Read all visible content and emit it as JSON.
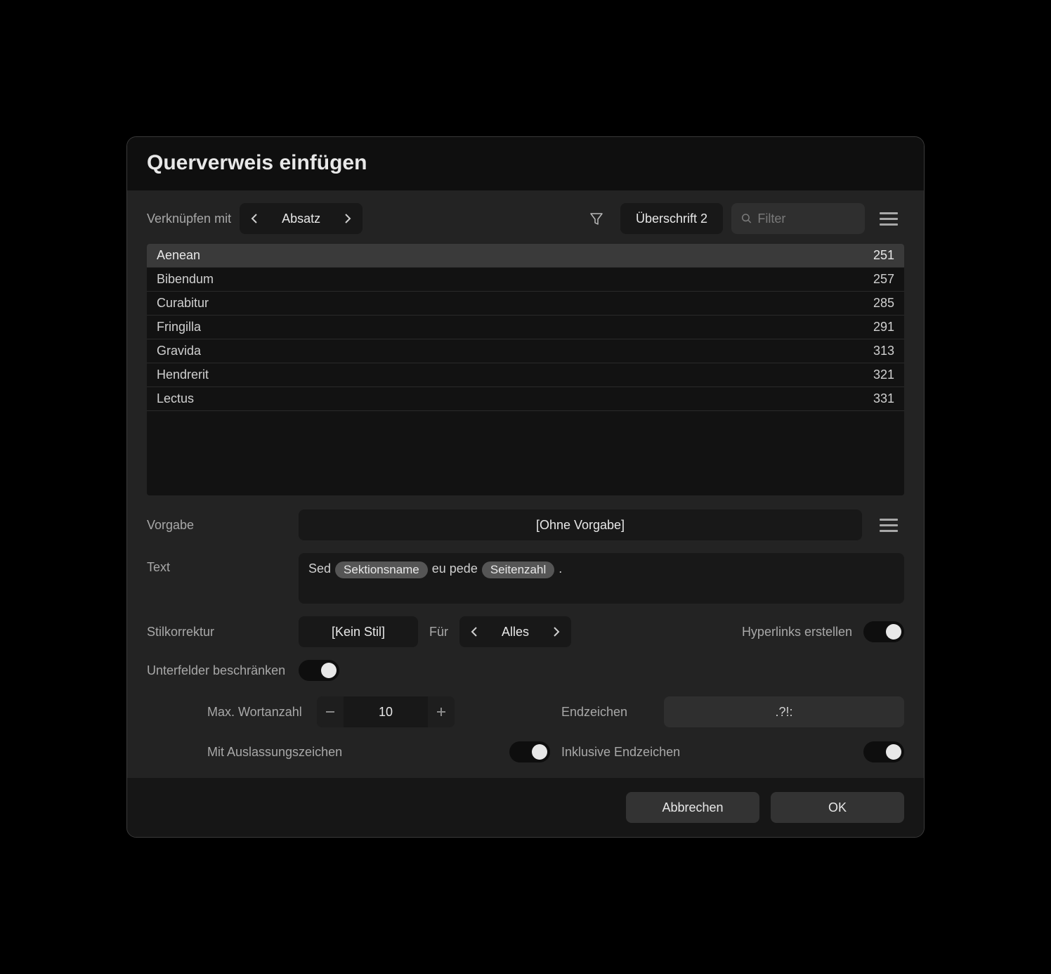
{
  "title": "Querverweis einfügen",
  "toolbar": {
    "link_with_label": "Verknüpfen mit",
    "link_with_value": "Absatz",
    "heading_filter": "Überschrift 2",
    "filter_placeholder": "Filter"
  },
  "list": [
    {
      "name": "Aenean",
      "page": "251",
      "selected": true
    },
    {
      "name": "Bibendum",
      "page": "257",
      "selected": false
    },
    {
      "name": "Curabitur",
      "page": "285",
      "selected": false
    },
    {
      "name": "Fringilla",
      "page": "291",
      "selected": false
    },
    {
      "name": "Gravida",
      "page": "313",
      "selected": false
    },
    {
      "name": "Hendrerit",
      "page": "321",
      "selected": false
    },
    {
      "name": "Lectus",
      "page": "331",
      "selected": false
    }
  ],
  "preset": {
    "label": "Vorgabe",
    "value": "[Ohne Vorgabe]"
  },
  "text_field": {
    "label": "Text",
    "parts": [
      {
        "type": "text",
        "value": "Sed"
      },
      {
        "type": "token",
        "value": "Sektionsname"
      },
      {
        "type": "text",
        "value": "eu pede"
      },
      {
        "type": "token",
        "value": "Seitenzahl"
      },
      {
        "type": "text",
        "value": "."
      }
    ]
  },
  "style": {
    "label": "Stilkorrektur",
    "value": "[Kein Stil]",
    "for_label": "Für",
    "for_value": "Alles",
    "hyperlinks_label": "Hyperlinks erstellen",
    "hyperlinks_on": true
  },
  "restrict": {
    "label": "Unterfelder beschränken",
    "on": true,
    "max_words_label": "Max. Wortanzahl",
    "max_words_value": "10",
    "end_chars_label": "Endzeichen",
    "end_chars_value": ".?!:",
    "ellipsis_label": "Mit Auslassungszeichen",
    "ellipsis_on": true,
    "include_end_label": "Inklusive Endzeichen",
    "include_end_on": true
  },
  "footer": {
    "cancel": "Abbrechen",
    "ok": "OK"
  }
}
